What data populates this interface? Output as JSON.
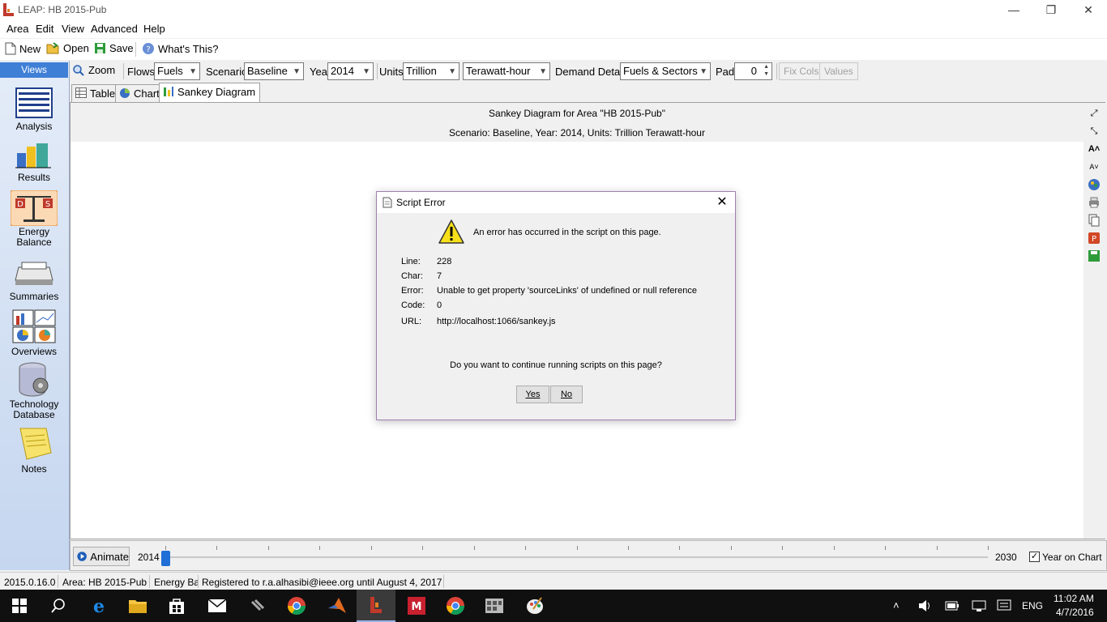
{
  "window": {
    "title": "LEAP: HB 2015-Pub",
    "minimize": "—",
    "restore": "❐",
    "close": "✕"
  },
  "menu": [
    "Area",
    "Edit",
    "View",
    "Advanced",
    "Help"
  ],
  "toolbar": {
    "new": "New",
    "open": "Open",
    "save": "Save",
    "whats_this": "What's This?"
  },
  "views": {
    "header": "Views",
    "items": [
      {
        "label": "Analysis"
      },
      {
        "label": "Results"
      },
      {
        "label": "Energy Balance"
      },
      {
        "label": "Summaries"
      },
      {
        "label": "Overviews"
      },
      {
        "label": "Technology Database"
      },
      {
        "label": "Notes"
      }
    ]
  },
  "options": {
    "zoom": "Zoom",
    "flows_label": "Flows:",
    "flows_value": "Fuels",
    "scenario_label": "Scenario:",
    "scenario_value": "Baseline",
    "year_label": "Year:",
    "year_value": "2014",
    "units_label": "Units:",
    "units_value": "Trillion",
    "units2_value": "Terawatt-hour",
    "demand_label": "Demand Detail:",
    "demand_value": "Fuels & Sectors",
    "pad_label": "Pad:",
    "pad_value": "0",
    "fix_cols": "Fix Cols",
    "values": "Values"
  },
  "tabs": [
    {
      "label": "Table"
    },
    {
      "label": "Chart"
    },
    {
      "label": "Sankey Diagram"
    }
  ],
  "sankey": {
    "title": "Sankey Diagram for Area \"HB 2015-Pub\"",
    "subtitle": "Scenario: Baseline, Year: 2014, Units: Trillion Terawatt-hour"
  },
  "dialog": {
    "title": "Script Error",
    "message": "An error has occurred in the script on this page.",
    "rows": [
      {
        "label": "Line:",
        "value": "228"
      },
      {
        "label": "Char:",
        "value": "7"
      },
      {
        "label": "Error:",
        "value": "Unable to get property 'sourceLinks' of undefined or null reference"
      },
      {
        "label": "Code:",
        "value": "0"
      },
      {
        "label": "URL:",
        "value": "http://localhost:1066/sankey.js"
      }
    ],
    "question": "Do you want to continue running scripts on this page?",
    "yes": "Yes",
    "no": "No"
  },
  "animate": {
    "button": "Animate",
    "start_year": "2014",
    "end_year": "2030",
    "year_on_chart": "Year on Chart",
    "year_on_chart_checked": true,
    "position": 0
  },
  "status": {
    "version": "2015.0.16.0",
    "area": "Area: HB 2015-Pub",
    "view": "Energy Ba",
    "registration": "Registered to r.a.alhasibi@ieee.org until August 4, 2017"
  },
  "taskbar": {
    "apps": [
      "start",
      "search",
      "edge",
      "file-explorer",
      "store",
      "mail",
      "app-generic",
      "chrome",
      "matlab",
      "leap",
      "mendeley",
      "chrome-2",
      "app-grid",
      "paint"
    ],
    "language": "ENG",
    "time": "11:02 AM",
    "date": "4/7/2016"
  }
}
